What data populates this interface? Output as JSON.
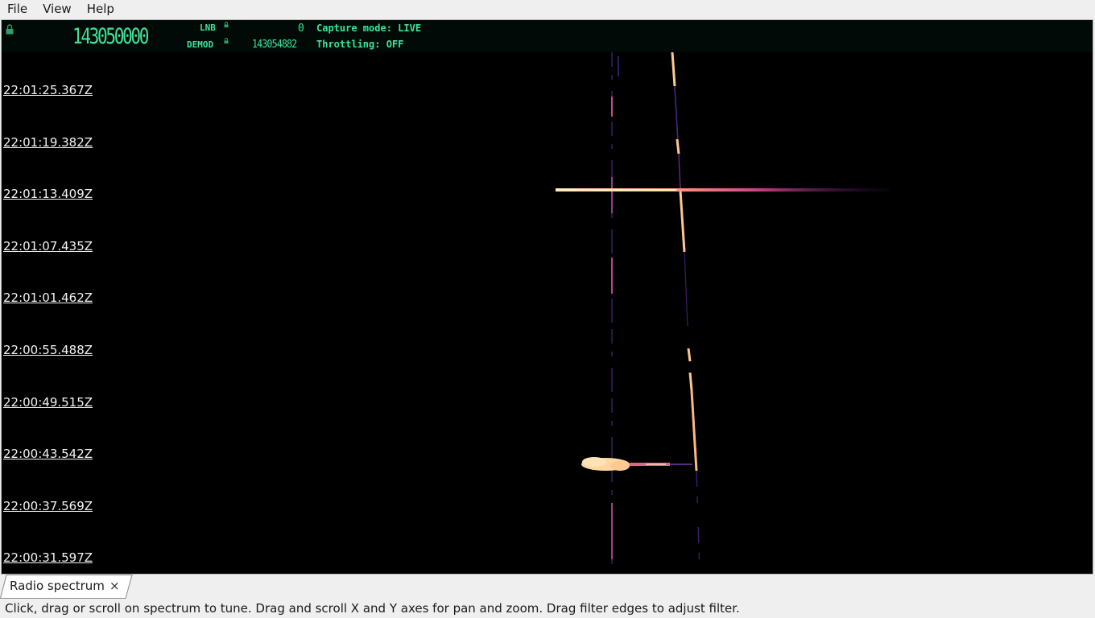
{
  "menu": {
    "file": "File",
    "view": "View",
    "help": "Help"
  },
  "header": {
    "frequency": "143050000",
    "lnb_label": "LNB",
    "lnb_value": "0",
    "demod_label": "DEMOD",
    "demod_value": "143054882",
    "capture_mode": "Capture mode: LIVE",
    "throttling": "Throttling: OFF",
    "accent_color": "#3ee39a",
    "lock_icon": "lock-icon"
  },
  "waterfall": {
    "timestamps": [
      "22:01:25.367Z",
      "22:01:19.382Z",
      "22:01:13.409Z",
      "22:01:07.435Z",
      "22:01:01.462Z",
      "22:00:55.488Z",
      "22:00:49.515Z",
      "22:00:43.542Z",
      "22:00:37.569Z",
      "22:00:31.597Z"
    ],
    "signal_color": "#ffcf90",
    "background": "#000000"
  },
  "tabs": [
    {
      "label": "Radio spectrum",
      "close": "×"
    }
  ],
  "statusbar": {
    "hint": "Click, drag or scroll on spectrum to tune. Drag and scroll X and Y axes for pan and zoom. Drag filter edges to adjust filter."
  }
}
